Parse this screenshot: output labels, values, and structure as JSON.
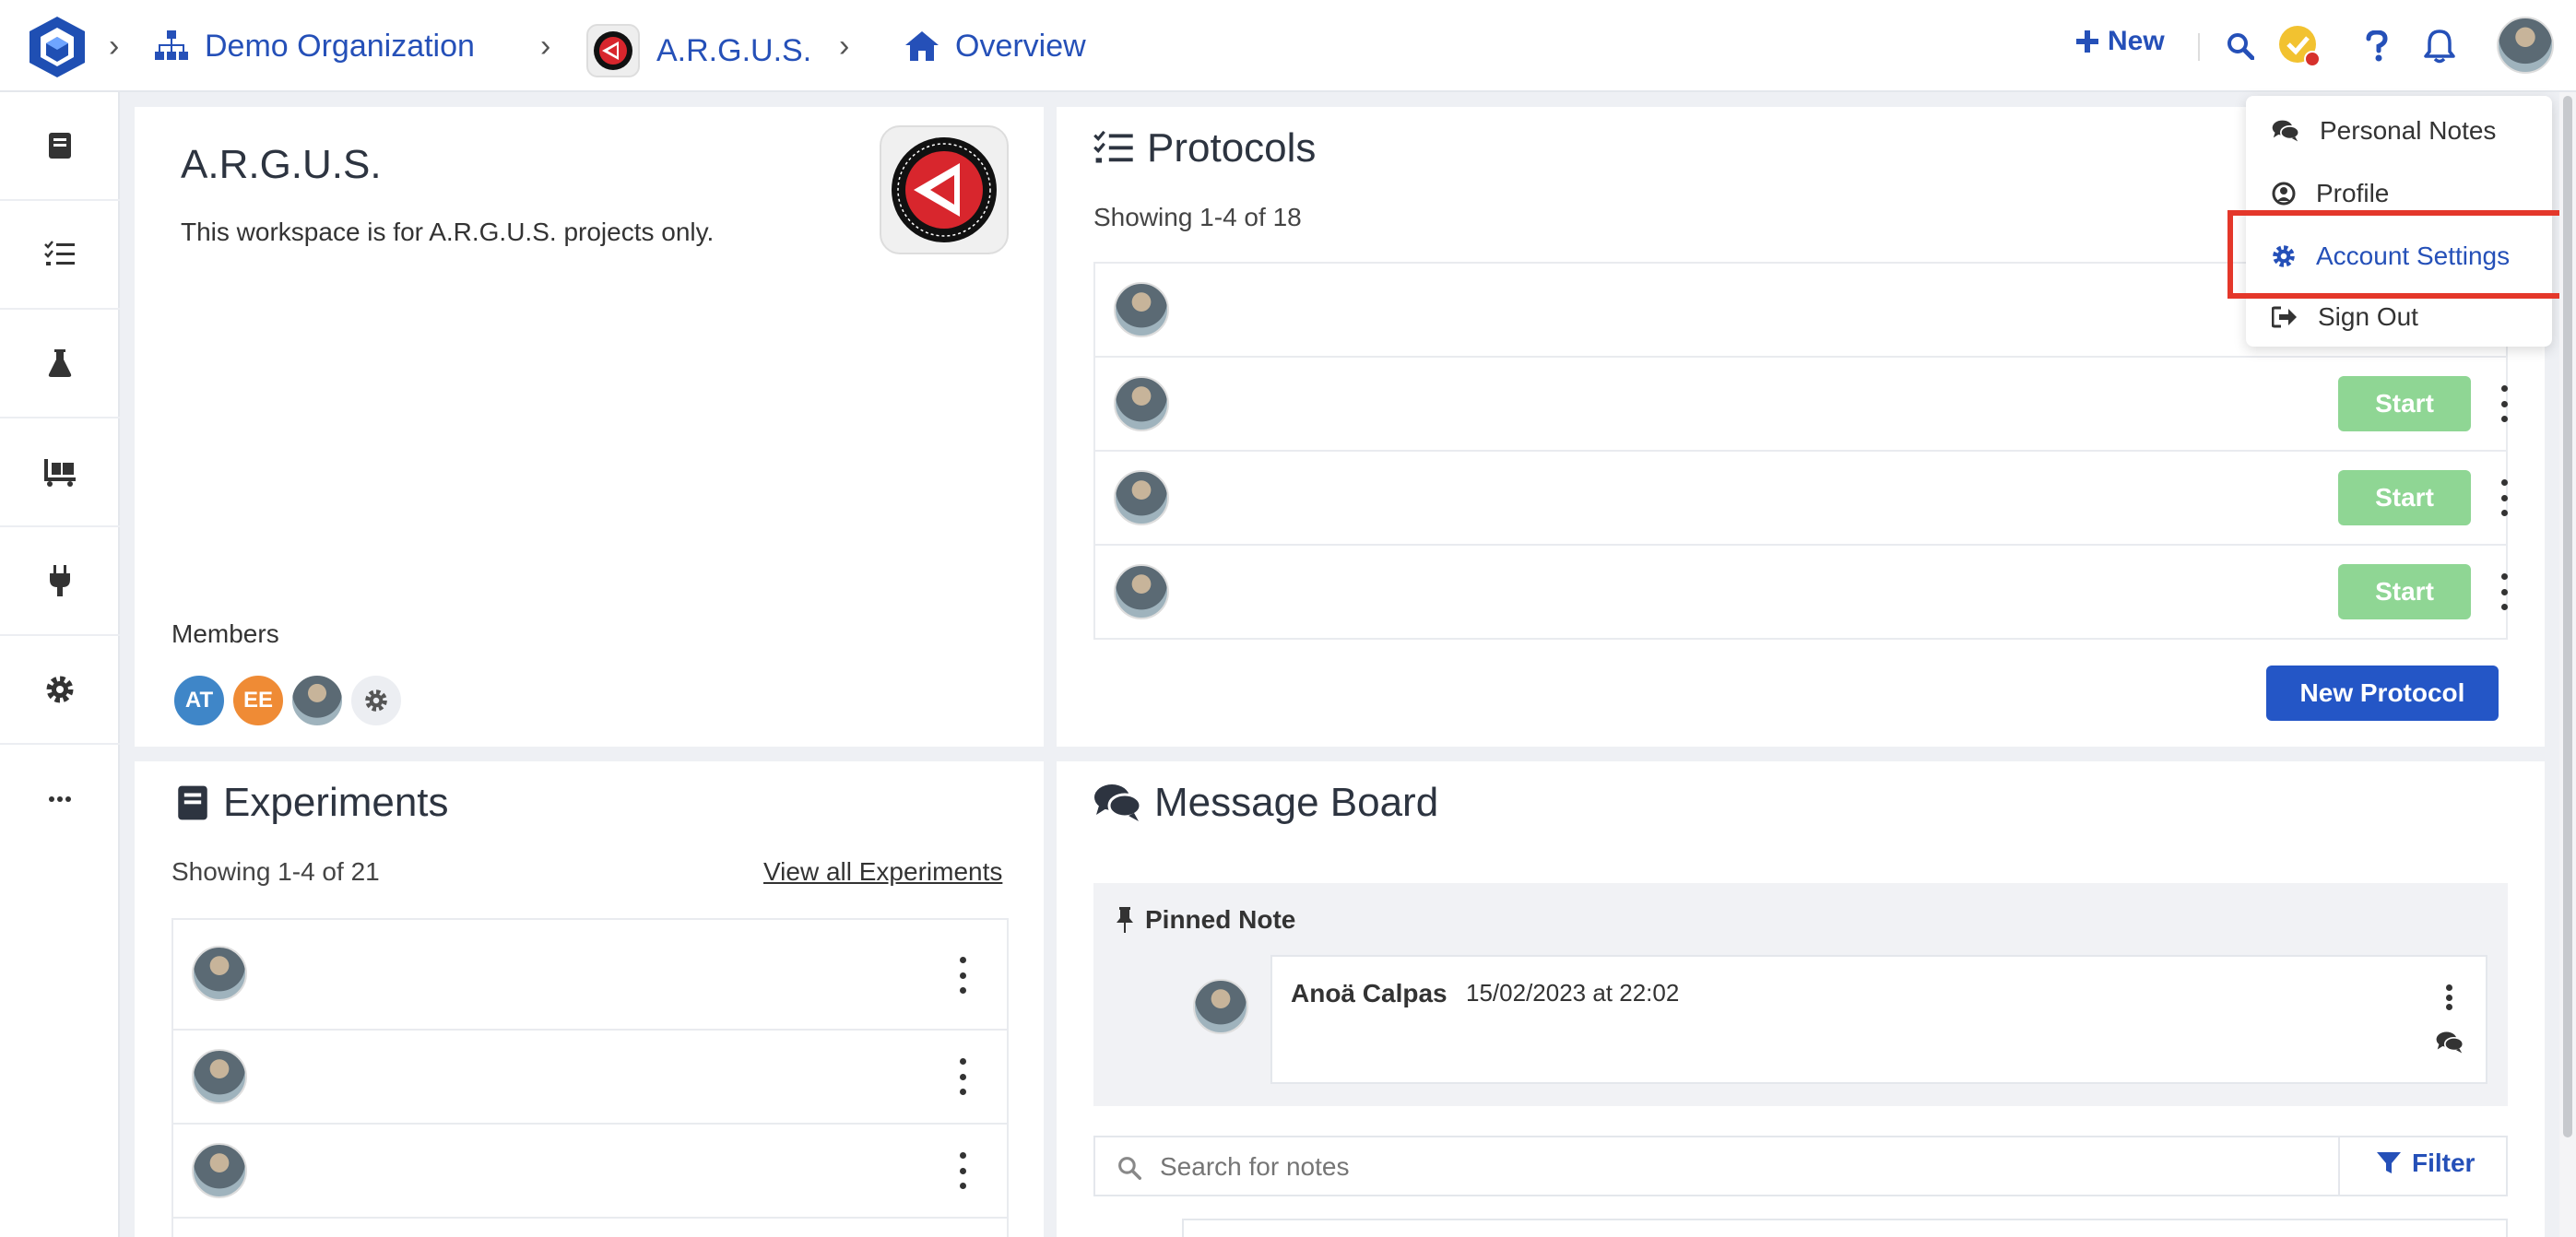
{
  "topbar": {
    "org": "Demo Organization",
    "workspace": "A.R.G.U.S.",
    "page": "Overview",
    "new_label": "New"
  },
  "workspace_card": {
    "title": "A.R.G.U.S.",
    "description": "This workspace is for A.R.G.U.S. projects only.",
    "members_label": "Members",
    "members": [
      {
        "initials": "AT",
        "color": "#3f86c8"
      },
      {
        "initials": "EE",
        "color": "#ef8b35"
      }
    ]
  },
  "protocols": {
    "title": "Protocols",
    "showing": "Showing 1-4 of 18",
    "start_label": "Start",
    "new_button": "New Protocol"
  },
  "experiments": {
    "title": "Experiments",
    "showing": "Showing 1-4 of 21",
    "view_all": "View all Experiments"
  },
  "message_board": {
    "title": "Message Board",
    "pinned_label": "Pinned Note",
    "note_author": "Anoä Calpas",
    "note_time": "15/02/2023 at 22:02",
    "search_placeholder": "Search for notes",
    "filter_label": "Filter"
  },
  "user_menu": {
    "items": [
      {
        "label": "Personal Notes",
        "icon": "comments-icon"
      },
      {
        "label": "Profile",
        "icon": "user-circle-icon"
      },
      {
        "label": "Account Settings",
        "icon": "gear-icon"
      },
      {
        "label": "Sign Out",
        "icon": "sign-out-icon"
      }
    ]
  },
  "colors": {
    "accent": "#2550b8",
    "start_button": "#8fd694",
    "new_protocol_button": "#2456c6",
    "highlight": "#e4372a"
  }
}
